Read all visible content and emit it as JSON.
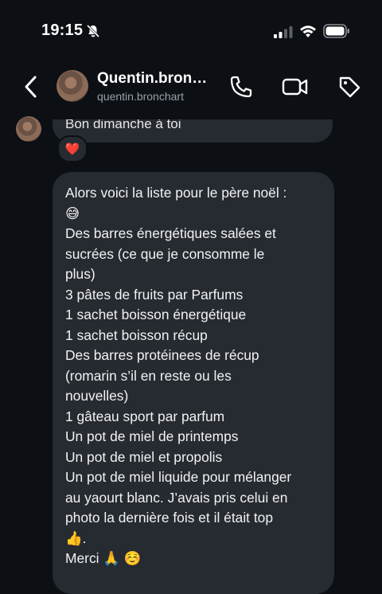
{
  "status_bar": {
    "time": "19:15"
  },
  "header": {
    "name": "Quentin.bron…",
    "username": "quentin.bronchart"
  },
  "previous_message": {
    "text": "Bon dimanche à toi",
    "reaction": "❤️"
  },
  "message": {
    "lines": [
      "Alors voici la liste pour le père noël :",
      "😅",
      "Des barres énergétiques salées et",
      "sucrées (ce que je consomme le",
      "plus)",
      "3 pâtes de fruits par Parfums",
      "1 sachet boisson énergétique",
      "1 sachet boisson récup",
      "Des barres protéinees de récup",
      "(romarin s’il en reste ou les",
      "nouvelles)",
      "1 gâteau sport par parfum",
      "Un pot de miel de printemps",
      "Un pot de miel et propolis",
      "Un pot de miel liquide pour mélanger",
      "au yaourt blanc. J’avais pris celui en",
      "photo la dernière fois et il était top",
      "👍.",
      "Merci 🙏 ☺️"
    ]
  },
  "icons": {
    "notifications": "bell-off-icon",
    "signal": "signal-icon",
    "wifi": "wifi-icon",
    "battery": "battery-icon",
    "back": "chevron-left-icon",
    "call": "phone-icon",
    "video": "video-camera-icon",
    "tag": "tag-icon"
  }
}
